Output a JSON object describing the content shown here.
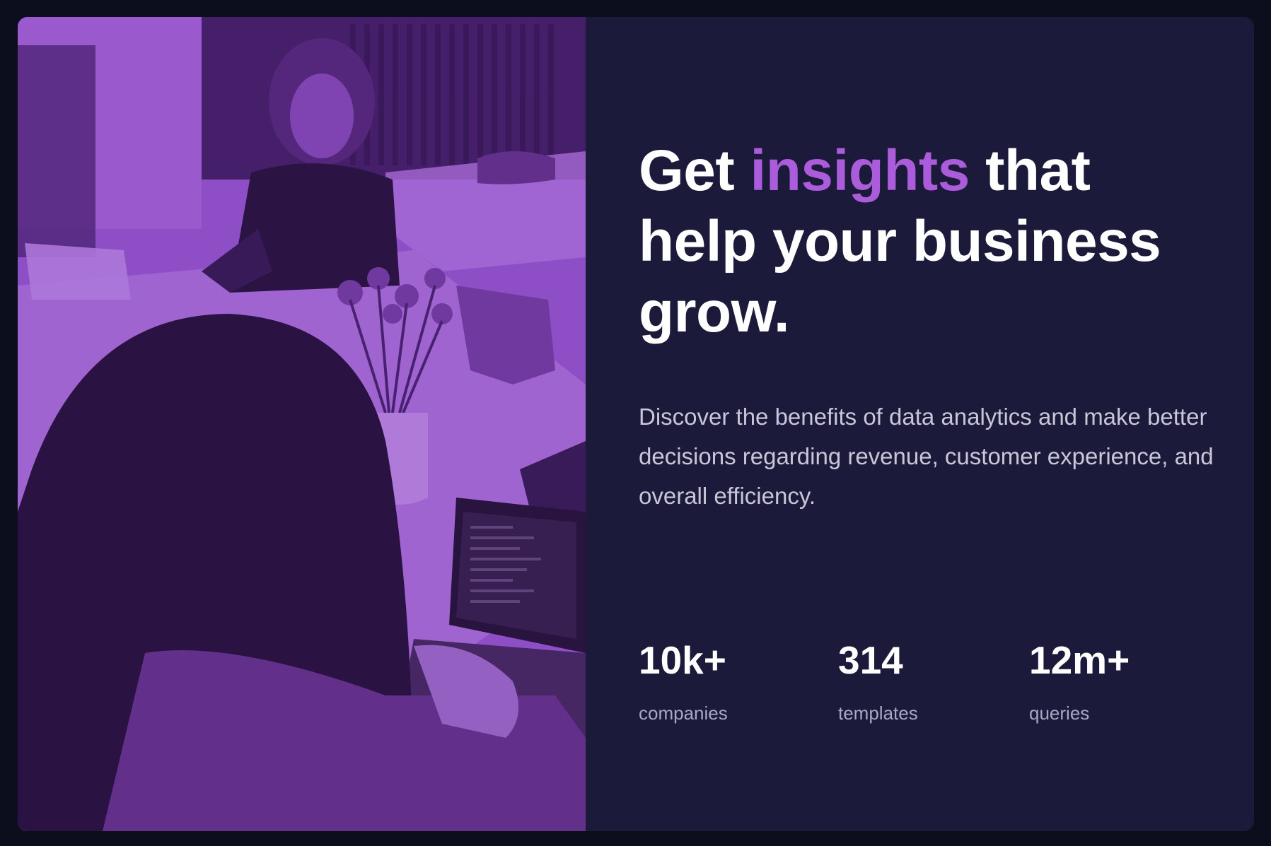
{
  "hero": {
    "headline_pre": "Get ",
    "headline_accent": "insights",
    "headline_post": " that help your business grow.",
    "description": "Discover the benefits of data analytics and make better decisions regarding revenue, customer experience, and overall efficiency."
  },
  "stats": [
    {
      "value": "10k+",
      "label": "companies"
    },
    {
      "value": "314",
      "label": "templates"
    },
    {
      "value": "12m+",
      "label": "queries"
    }
  ],
  "colors": {
    "page_background": "#0c0e1e",
    "card_background": "#1c1a3a",
    "accent": "#ab5cdb",
    "image_tint": "#9a56d8",
    "description_text": "#c8c6d8",
    "stat_label_text": "#a9a7c1"
  }
}
